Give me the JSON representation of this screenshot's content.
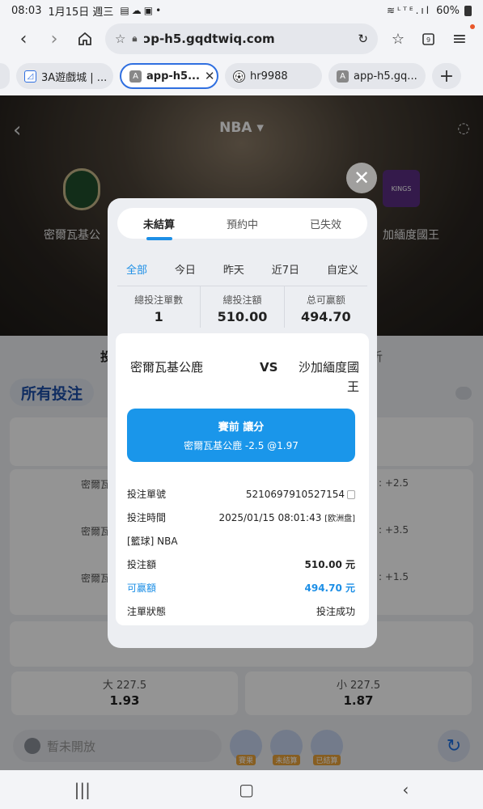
{
  "status_bar": {
    "time": "08:03",
    "date": "1月15日 週三",
    "battery": "60%"
  },
  "browser": {
    "url": "ɔp-h5.gqdtwiq.com",
    "tabs": [
      {
        "label": "3A遊戲城 | ...",
        "favicon": "picture-icon"
      },
      {
        "label": "app-h5...",
        "favicon": "A",
        "active": true
      },
      {
        "label": "hr9988",
        "favicon": "soccer-ball-icon"
      },
      {
        "label": "app-h5.gq...",
        "favicon": "A"
      }
    ]
  },
  "hero": {
    "league": "NBA ▾",
    "home_team": "密爾瓦基公",
    "away_team": "加緬度國王",
    "away_logo_text": "KINGS"
  },
  "background": {
    "tab_left": "投",
    "tab_right": "析",
    "all_bets": "所有投注",
    "rows": [
      "密爾瓦",
      "密爾瓦",
      "密爾瓦"
    ],
    "row_odds": [
      ": +2.5",
      ": +3.5",
      ": +1.5"
    ],
    "over": {
      "label": "大 227.5",
      "value": "1.93"
    },
    "under": {
      "label": "小 227.5",
      "value": "1.87"
    },
    "chat_placeholder": "暫未開放",
    "bottom_buttons": [
      "賽果",
      "未結算",
      "已結算"
    ]
  },
  "modal": {
    "tabs": [
      "未結算",
      "預約中",
      "已失效"
    ],
    "active_tab": 0,
    "ranges": [
      "全部",
      "今日",
      "昨天",
      "近7日",
      "自定义"
    ],
    "active_range": 0,
    "summary": [
      {
        "label": "總投注單數",
        "value": "1"
      },
      {
        "label": "總投注額",
        "value": "510.00"
      },
      {
        "label": "总可赢额",
        "value": "494.70"
      }
    ],
    "home_team": "密爾瓦基公鹿",
    "vs": "VS",
    "away_team": "沙加緬度國王",
    "bet_type": "賽前 讓分",
    "bet_selection": "密爾瓦基公鹿 -2.5 @1.97",
    "details": {
      "order_no_label": "投注單號",
      "order_no": "5210697910527154",
      "time_label": "投注時間",
      "time": "2025/01/15 08:01:43",
      "odds_type": "[欧洲盘]",
      "sport": "[籃球] NBA",
      "stake_label": "投注額",
      "stake": "510.00 元",
      "win_label": "可赢額",
      "win": "494.70 元",
      "status_label": "注單狀態",
      "status": "投注成功"
    }
  },
  "colors": {
    "accent": "#1a96ea",
    "brand_blue": "#1d4fa8"
  }
}
